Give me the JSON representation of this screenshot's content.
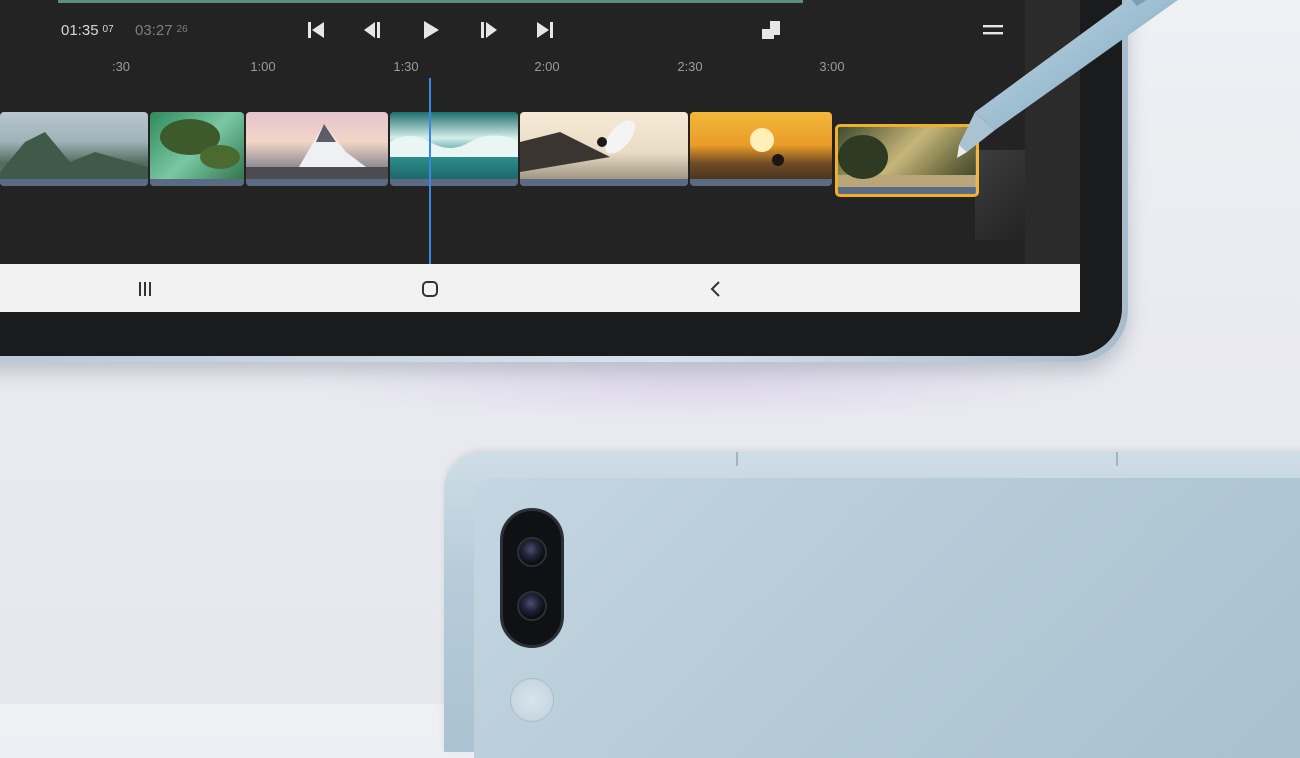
{
  "player": {
    "current_time": "01:35",
    "current_frames": "07",
    "total_time": "03:27",
    "total_frames": "26"
  },
  "icons": {
    "skip_start": "skip-to-start-icon",
    "step_back": "step-back-icon",
    "play": "play-icon",
    "step_forward": "step-forward-icon",
    "skip_end": "skip-to-end-icon",
    "aspect": "aspect-ratio-icon",
    "menu": "hamburger-menu-icon"
  },
  "ruler": [
    ":30",
    "1:00",
    "1:30",
    "2:00",
    "2:30",
    "3:00"
  ],
  "clips": [
    {
      "scene": "mountain-valley"
    },
    {
      "scene": "aerial-forest-coast"
    },
    {
      "scene": "snowy-peak-waterfall"
    },
    {
      "scene": "ocean-waves"
    },
    {
      "scene": "surfer-jump"
    },
    {
      "scene": "sunset-surfer"
    },
    {
      "scene": "forest-sunlight",
      "selected": true
    }
  ],
  "navigation": {
    "recent": "recent-apps-icon",
    "home": "home-icon",
    "back": "back-icon"
  },
  "colors": {
    "screen_bg": "#232323",
    "playhead": "#3a86e6",
    "selected_clip": "#f0b02a",
    "navbar_bg": "#f2f2f2"
  }
}
